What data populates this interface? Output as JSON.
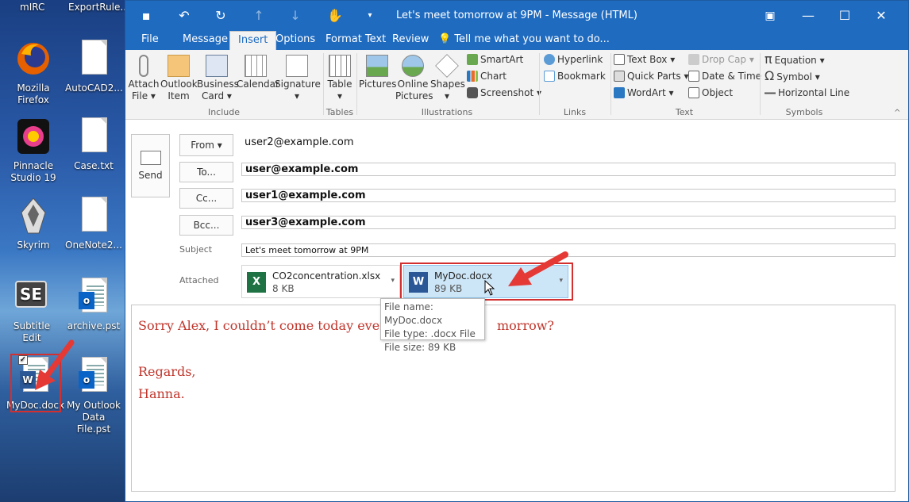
{
  "desktop": {
    "top_labels": [
      "mIRC",
      "ExportRule..."
    ],
    "icons": [
      {
        "label1": "Mozilla",
        "label2": "Firefox"
      },
      {
        "label1": "AutoCAD2...",
        "label2": ""
      },
      {
        "label1": "Pinnacle",
        "label2": "Studio 19"
      },
      {
        "label1": "Case.txt",
        "label2": ""
      },
      {
        "label1": "Skyrim",
        "label2": ""
      },
      {
        "label1": "OneNote2...",
        "label2": ""
      },
      {
        "label1": "Subtitle Edit",
        "label2": ""
      },
      {
        "label1": "archive.pst",
        "label2": ""
      },
      {
        "label1": "MyDoc.docx",
        "label2": ""
      },
      {
        "label1": "My Outlook",
        "label2": "Data File.pst"
      }
    ],
    "se_text": "SE"
  },
  "window": {
    "title": "Let's meet tomorrow at 9PM - Message (HTML)",
    "tabs": [
      "File",
      "Message",
      "Insert",
      "Options",
      "Format Text",
      "Review"
    ],
    "tell_me": "Tell me what you want to do..."
  },
  "ribbon": {
    "include": {
      "label": "Include",
      "buttons": [
        {
          "l1": "Attach",
          "l2": "File ▾"
        },
        {
          "l1": "Outlook",
          "l2": "Item"
        },
        {
          "l1": "Business",
          "l2": "Card ▾"
        },
        {
          "l1": "Calendar",
          "l2": ""
        },
        {
          "l1": "Signature",
          "l2": "▾"
        }
      ]
    },
    "tables": {
      "label": "Tables",
      "btn": "Table",
      "arrow": "▾"
    },
    "illustrations": {
      "label": "Illustrations",
      "pictures": "Pictures",
      "online1": "Online",
      "online2": "Pictures",
      "shapes": "Shapes",
      "shapes_arrow": "▾",
      "smartart": "SmartArt",
      "chart": "Chart",
      "screenshot": "Screenshot ▾"
    },
    "links": {
      "label": "Links",
      "hyperlink": "Hyperlink",
      "bookmark": "Bookmark"
    },
    "text": {
      "label": "Text",
      "textbox": "Text Box ▾",
      "quickparts": "Quick Parts ▾",
      "wordart": "WordArt ▾",
      "dropcap": "Drop Cap ▾",
      "datetime": "Date & Time",
      "object": "Object"
    },
    "symbols": {
      "label": "Symbols",
      "equation": "Equation ▾",
      "symbol": "Symbol ▾",
      "hline": "Horizontal Line",
      "pi": "π",
      "omega": "Ω"
    }
  },
  "compose": {
    "send": "Send",
    "from_btn": "From ▾",
    "from_value": "user2@example.com",
    "to_btn": "To...",
    "to_value": "user@example.com",
    "cc_btn": "Cc...",
    "cc_value": "user1@example.com",
    "bcc_btn": "Bcc...",
    "bcc_value": "user3@example.com",
    "subject_label": "Subject",
    "subject_value": "Let's meet tomorrow at 9PM",
    "attached_label": "Attached",
    "attachments": [
      {
        "name": "CO2concentration.xlsx",
        "size": "8 KB",
        "badge": "X"
      },
      {
        "name": "MyDoc.docx",
        "size": "89 KB",
        "badge": "W"
      }
    ],
    "tooltip": {
      "name": "File name:  MyDoc.docx",
      "type": "File type:  .docx File",
      "size": "File size:  89 KB"
    },
    "body": {
      "line1a": "Sorry Alex, I couldn’t come today evenin",
      "line1b": "morrow?",
      "line2": "Regards,",
      "line3": "Hanna."
    }
  },
  "colors": {
    "accent": "#1f6bc0",
    "highlight_box": "#d32f2f",
    "body_text": "#c0352b"
  }
}
